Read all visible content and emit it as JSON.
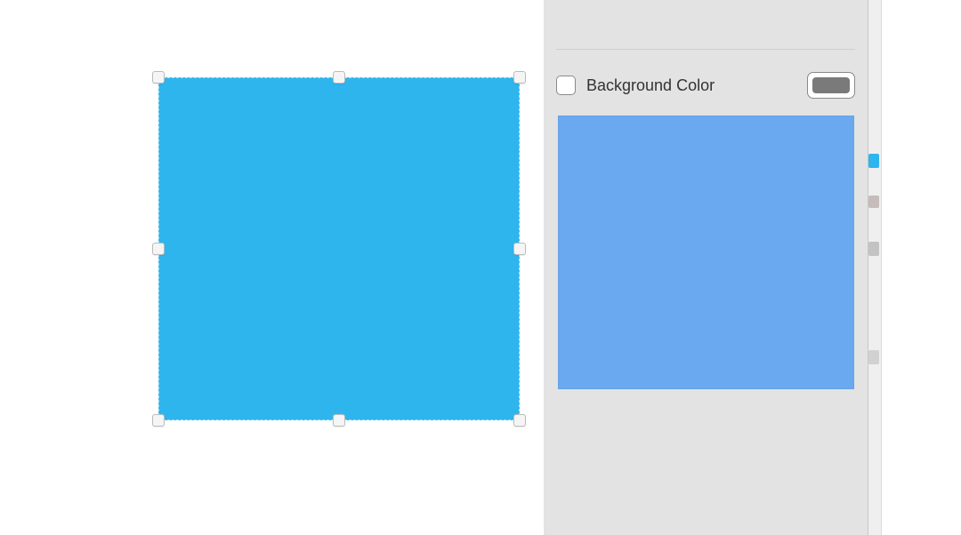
{
  "canvas": {
    "shape_color": "#2fb5ed"
  },
  "inspector": {
    "clipped_row_label": "",
    "background_color_label": "Background Color",
    "background_color_checked": false,
    "swatch_current": "#7a7a7a",
    "preview_color": "#6aa8ef"
  }
}
